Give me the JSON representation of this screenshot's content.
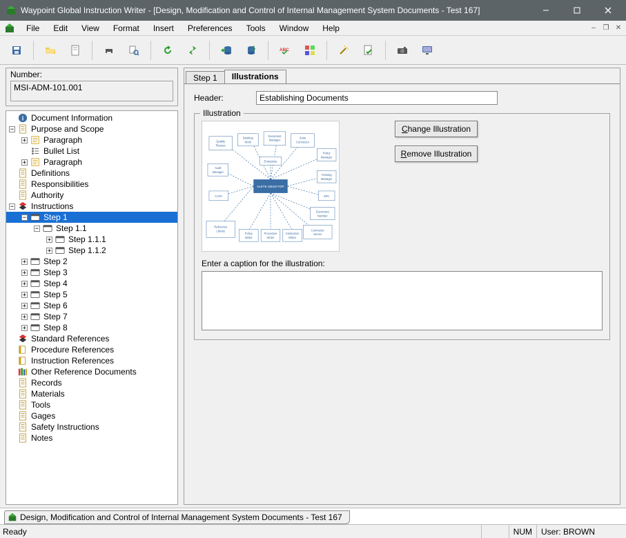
{
  "titlebar": {
    "title": "Waypoint Global Instruction Writer - [Design, Modification and Control of Internal Management System Documents - Test 167]"
  },
  "menu": {
    "items": [
      "File",
      "Edit",
      "View",
      "Format",
      "Insert",
      "Preferences",
      "Tools",
      "Window",
      "Help"
    ]
  },
  "number_panel": {
    "label": "Number:",
    "value": "MSI-ADM-101.001"
  },
  "tree": [
    {
      "depth": 0,
      "exp": "",
      "icon": "info",
      "label": "Document Information"
    },
    {
      "depth": 0,
      "exp": "-",
      "icon": "doc",
      "label": "Purpose and Scope"
    },
    {
      "depth": 1,
      "exp": "+",
      "icon": "para",
      "label": "Paragraph"
    },
    {
      "depth": 1,
      "exp": "",
      "icon": "bullet",
      "label": "Bullet List"
    },
    {
      "depth": 1,
      "exp": "+",
      "icon": "para",
      "label": "Paragraph"
    },
    {
      "depth": 0,
      "exp": "",
      "icon": "doc",
      "label": "Definitions"
    },
    {
      "depth": 0,
      "exp": "",
      "icon": "doc",
      "label": "Responsibilities"
    },
    {
      "depth": 0,
      "exp": "",
      "icon": "doc",
      "label": "Authority"
    },
    {
      "depth": 0,
      "exp": "-",
      "icon": "steps",
      "label": "Instructions"
    },
    {
      "depth": 1,
      "exp": "-",
      "icon": "step",
      "label": "Step 1",
      "selected": true
    },
    {
      "depth": 2,
      "exp": "-",
      "icon": "step",
      "label": "Step 1.1"
    },
    {
      "depth": 3,
      "exp": "+",
      "icon": "step",
      "label": "Step 1.1.1"
    },
    {
      "depth": 3,
      "exp": "+",
      "icon": "step",
      "label": "Step 1.1.2"
    },
    {
      "depth": 1,
      "exp": "+",
      "icon": "step",
      "label": "Step 2"
    },
    {
      "depth": 1,
      "exp": "+",
      "icon": "step",
      "label": "Step 3"
    },
    {
      "depth": 1,
      "exp": "+",
      "icon": "step",
      "label": "Step 4"
    },
    {
      "depth": 1,
      "exp": "+",
      "icon": "step",
      "label": "Step 5"
    },
    {
      "depth": 1,
      "exp": "+",
      "icon": "step",
      "label": "Step 6"
    },
    {
      "depth": 1,
      "exp": "+",
      "icon": "step",
      "label": "Step 7"
    },
    {
      "depth": 1,
      "exp": "+",
      "icon": "step",
      "label": "Step 8"
    },
    {
      "depth": 0,
      "exp": "",
      "icon": "steps",
      "label": "Standard References"
    },
    {
      "depth": 0,
      "exp": "",
      "icon": "ref",
      "label": "Procedure References"
    },
    {
      "depth": 0,
      "exp": "",
      "icon": "ref",
      "label": "Instruction References"
    },
    {
      "depth": 0,
      "exp": "",
      "icon": "books",
      "label": "Other Reference Documents"
    },
    {
      "depth": 0,
      "exp": "",
      "icon": "doc",
      "label": "Records"
    },
    {
      "depth": 0,
      "exp": "",
      "icon": "doc",
      "label": "Materials"
    },
    {
      "depth": 0,
      "exp": "",
      "icon": "doc",
      "label": "Tools"
    },
    {
      "depth": 0,
      "exp": "",
      "icon": "doc",
      "label": "Gages"
    },
    {
      "depth": 0,
      "exp": "",
      "icon": "doc",
      "label": "Safety Instructions"
    },
    {
      "depth": 0,
      "exp": "",
      "icon": "doc",
      "label": "Notes"
    }
  ],
  "tabs": {
    "step1": "Step 1",
    "illustrations": "Illustrations"
  },
  "header_row": {
    "label": "Header:",
    "value": "Establishing Documents"
  },
  "illustration": {
    "legend": "Illustration",
    "change_btn": "Change Illustration",
    "remove_btn": "Remove Illustration",
    "caption_label": "Enter a caption for the illustration:",
    "caption_value": "",
    "diagram_center": "SUITE DESKTOP",
    "diagram_boxes": [
      "Quality Planner",
      "Desktop Work",
      "Document Manager",
      "Suite Connector SharePoint",
      "Policy Manager",
      "Audit Manager",
      "Enterprise",
      "Training Manager",
      "SPC",
      "CAPA",
      "Document Number",
      "Policy Writer",
      "Procedure Writer",
      "Instruction Writer"
    ]
  },
  "doc_tab": {
    "label": "Design, Modification and Control of Internal Management System Documents - Test 167"
  },
  "status": {
    "ready": "Ready",
    "num": "NUM",
    "user": "User: BROWN"
  }
}
